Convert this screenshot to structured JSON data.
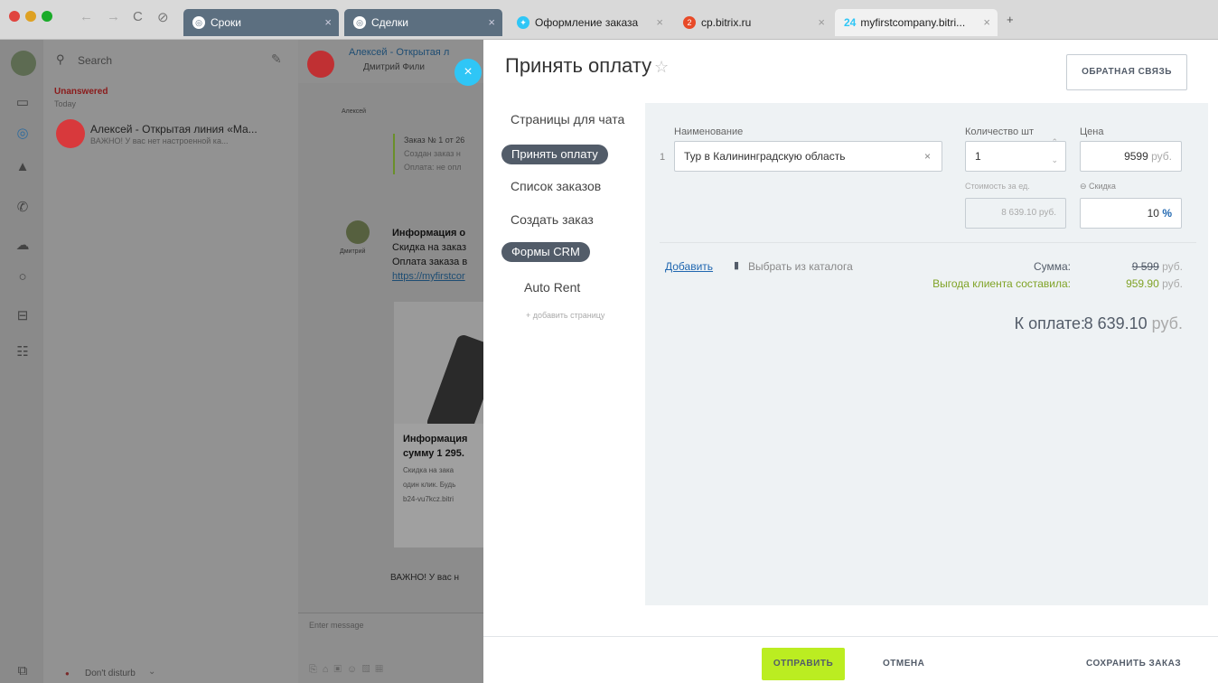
{
  "browser": {
    "tabs": [
      {
        "label": "Сроки"
      },
      {
        "label": "Сделки"
      },
      {
        "label": "Оформление заказа"
      },
      {
        "label": "cp.bitrix.ru"
      },
      {
        "label": "myfirstcompany.bitri..."
      }
    ],
    "new_tab": "+"
  },
  "chatlist": {
    "search_placeholder": "Search",
    "section": "Unanswered",
    "date": "Today",
    "item_title": "Алексей - Открытая линия «Ма...",
    "item_preview": "ВАЖНО! У вас нет настроенной ка...",
    "status": "Don't disturb"
  },
  "chat": {
    "header_name": "Алексей - Открытая л",
    "header_sub": "Дмитрий Фили",
    "avatar_label1": "Алексей",
    "order_line1": "Заказ № 1 от 26",
    "order_line2": "Создан заказ н",
    "order_line3": "Оплата: не опл",
    "avatar_label2": "Дмитрий",
    "info_title": "Информация о",
    "info_line1": "Скидка на заказ",
    "info_line2": "Оплата заказа в",
    "info_link": "https://myfirstcor",
    "card_title1": "Информация",
    "card_title2": "сумму 1 295.",
    "card_line1": "Скидка на зака",
    "card_line2": "один клик. Будь",
    "card_line3": "b24-vu7kcz.bitri",
    "important": "ВАЖНО! У вас н",
    "input_placeholder": "Enter message"
  },
  "panel": {
    "title": "Принять оплату",
    "feedback": "ОБРАТНАЯ СВЯЗЬ",
    "nav": {
      "pages": "Страницы для чата",
      "accept": "Принять оплату",
      "orders": "Список заказов",
      "create": "Создать заказ",
      "crm": "Формы CRM",
      "autorent": "Auto Rent",
      "add_page": "+ добавить страницу"
    },
    "form": {
      "name_label": "Наименование",
      "qty_label": "Количество шт",
      "price_label": "Цена",
      "row_num": "1",
      "product": "Тур в Калининградскую область",
      "qty": "1",
      "price": "9599",
      "currency_short": "руб.",
      "unit_cost_label": "Стоимость за ед.",
      "unit_cost": "8 639.10 руб.",
      "discount_label": "Скидка",
      "discount": "10",
      "percent": "%",
      "add": "Добавить",
      "catalog": "Выбрать из каталога",
      "sum_label": "Сумма:",
      "sum_value": "9 599",
      "benefit_label": "Выгода клиента составила:",
      "benefit_value": "959.90",
      "total_label": "К оплате:",
      "total_value": "8 639.10",
      "total_currency": "руб."
    },
    "footer": {
      "send": "ОТПРАВИТЬ",
      "cancel": "ОТМЕНА",
      "save": "СОХРАНИТЬ ЗАКАЗ"
    }
  },
  "colors": {
    "accent": "#bbed21",
    "pill": "#525c69",
    "link": "#2067b0",
    "benefit": "#80a327"
  }
}
